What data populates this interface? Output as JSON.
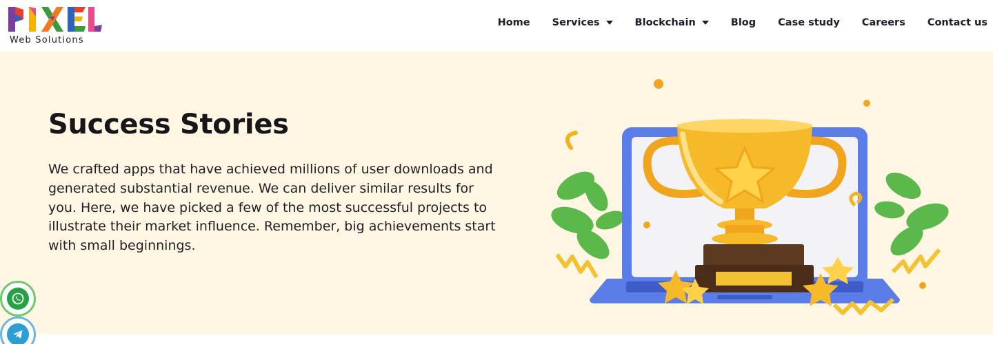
{
  "header": {
    "logo": {
      "wordmark": "PIXEL",
      "tagline": "Web Solutions"
    },
    "nav": [
      {
        "label": "Home",
        "has_dropdown": false
      },
      {
        "label": "Services",
        "has_dropdown": true
      },
      {
        "label": "Blockchain",
        "has_dropdown": true
      },
      {
        "label": "Blog",
        "has_dropdown": false
      },
      {
        "label": "Case study",
        "has_dropdown": false
      },
      {
        "label": "Careers",
        "has_dropdown": false
      },
      {
        "label": "Contact us",
        "has_dropdown": false
      }
    ]
  },
  "hero": {
    "title": "Success Stories",
    "description": "We crafted apps that have achieved millions of user downloads and generated substantial revenue. We can deliver similar results for you. Here, we have picked a few of the most successful projects to illustrate their market influence. Remember, big achievements start with small beginnings.",
    "illustration": "trophy-on-laptop-illustration"
  },
  "floating_buttons": [
    {
      "icon": "whatsapp-icon"
    },
    {
      "icon": "telegram-icon"
    }
  ],
  "colors": {
    "hero_background": "#fff6e3",
    "text": "#1d1d2b",
    "whatsapp": "#25a244",
    "telegram": "#2a9fd6"
  }
}
